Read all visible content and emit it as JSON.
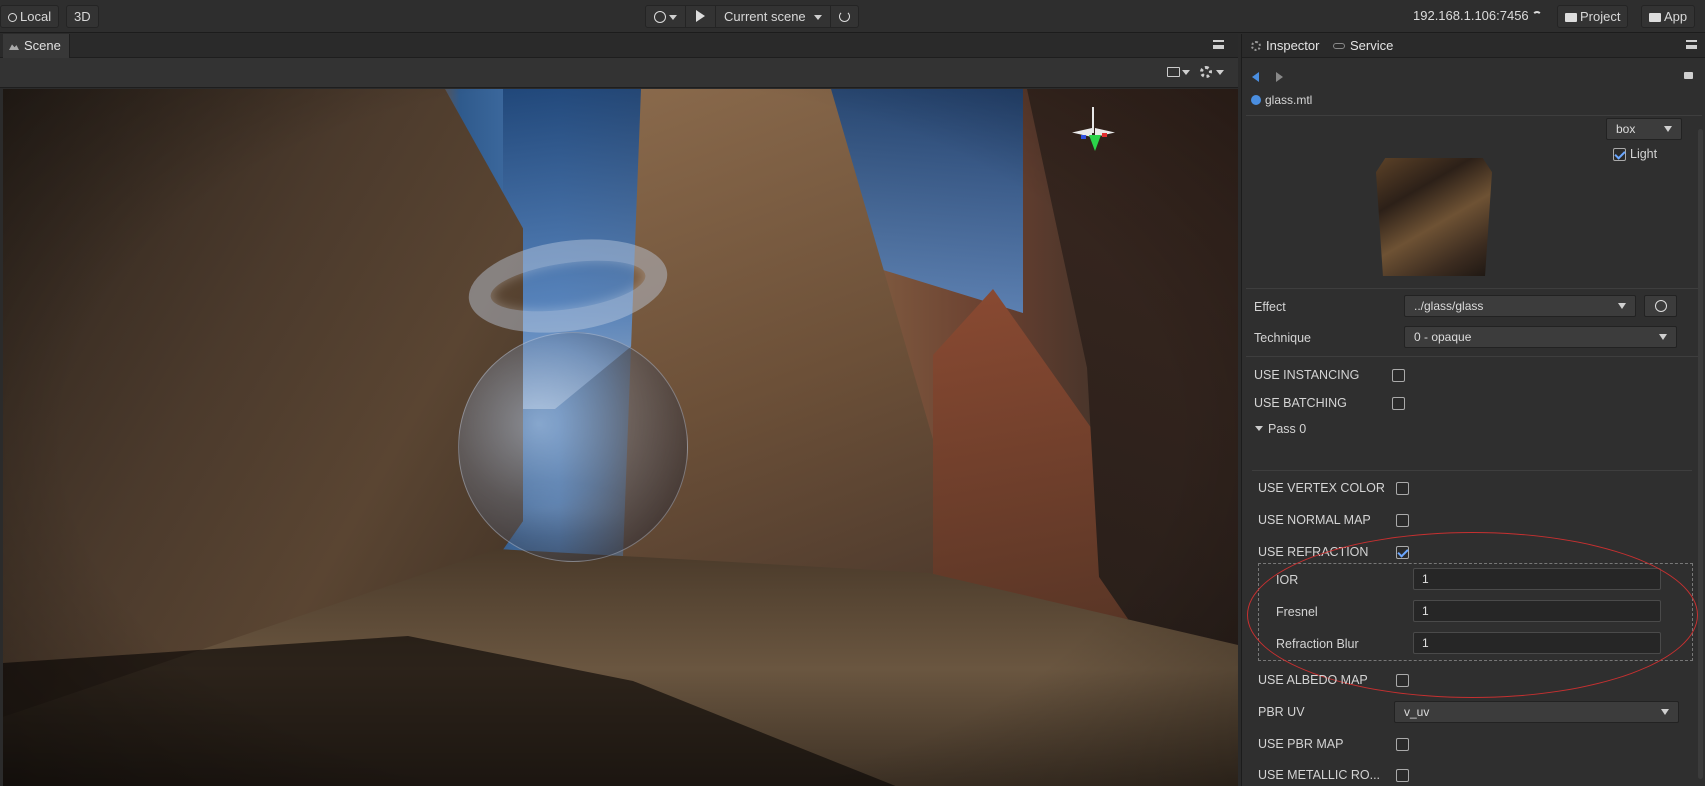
{
  "toolbar": {
    "local_label": "Local",
    "mode_label": "3D",
    "scene_select_label": "Current scene",
    "server_address": "192.168.1.106:7456",
    "project_label": "Project",
    "app_label": "App"
  },
  "scene": {
    "tab_label": "Scene"
  },
  "inspector": {
    "tabs": [
      {
        "label": "Inspector"
      },
      {
        "label": "Service"
      }
    ],
    "asset_name": "glass.mtl",
    "preview": {
      "shape_select": "box",
      "light_label": "Light",
      "light_checked": true
    },
    "effect": {
      "label": "Effect",
      "value": "../glass/glass"
    },
    "technique": {
      "label": "Technique",
      "value": "0 - opaque"
    },
    "use_instancing": {
      "label": "USE  INSTANCING",
      "checked": false
    },
    "use_batching": {
      "label": "USE  BATCHING",
      "checked": false
    },
    "pass_label": "Pass 0",
    "use_vertex_color": {
      "label": "USE  VERTEX  COLOR",
      "checked": false
    },
    "use_normal_map": {
      "label": "USE  NORMAL  MAP",
      "checked": false
    },
    "use_refraction": {
      "label": "USE  REFRACTION",
      "checked": true
    },
    "ior": {
      "label": "IOR",
      "value": "1"
    },
    "fresnel": {
      "label": "Fresnel",
      "value": "1"
    },
    "refraction_blur": {
      "label": "Refraction  Blur",
      "value": "1"
    },
    "use_albedo_map": {
      "label": "USE  ALBEDO  MAP",
      "checked": false
    },
    "pbr_uv": {
      "label": "PBR  UV",
      "value": "v_uv"
    },
    "use_pbr_map": {
      "label": "USE  PBR  MAP",
      "checked": false
    },
    "use_metallic_ro": {
      "label": "USE  METALLIC  RO...",
      "checked": false
    }
  },
  "colors": {
    "accent_blue": "#4a8ee0",
    "annotation_red": "#c63030",
    "panel_bg": "#2f2f2f"
  }
}
